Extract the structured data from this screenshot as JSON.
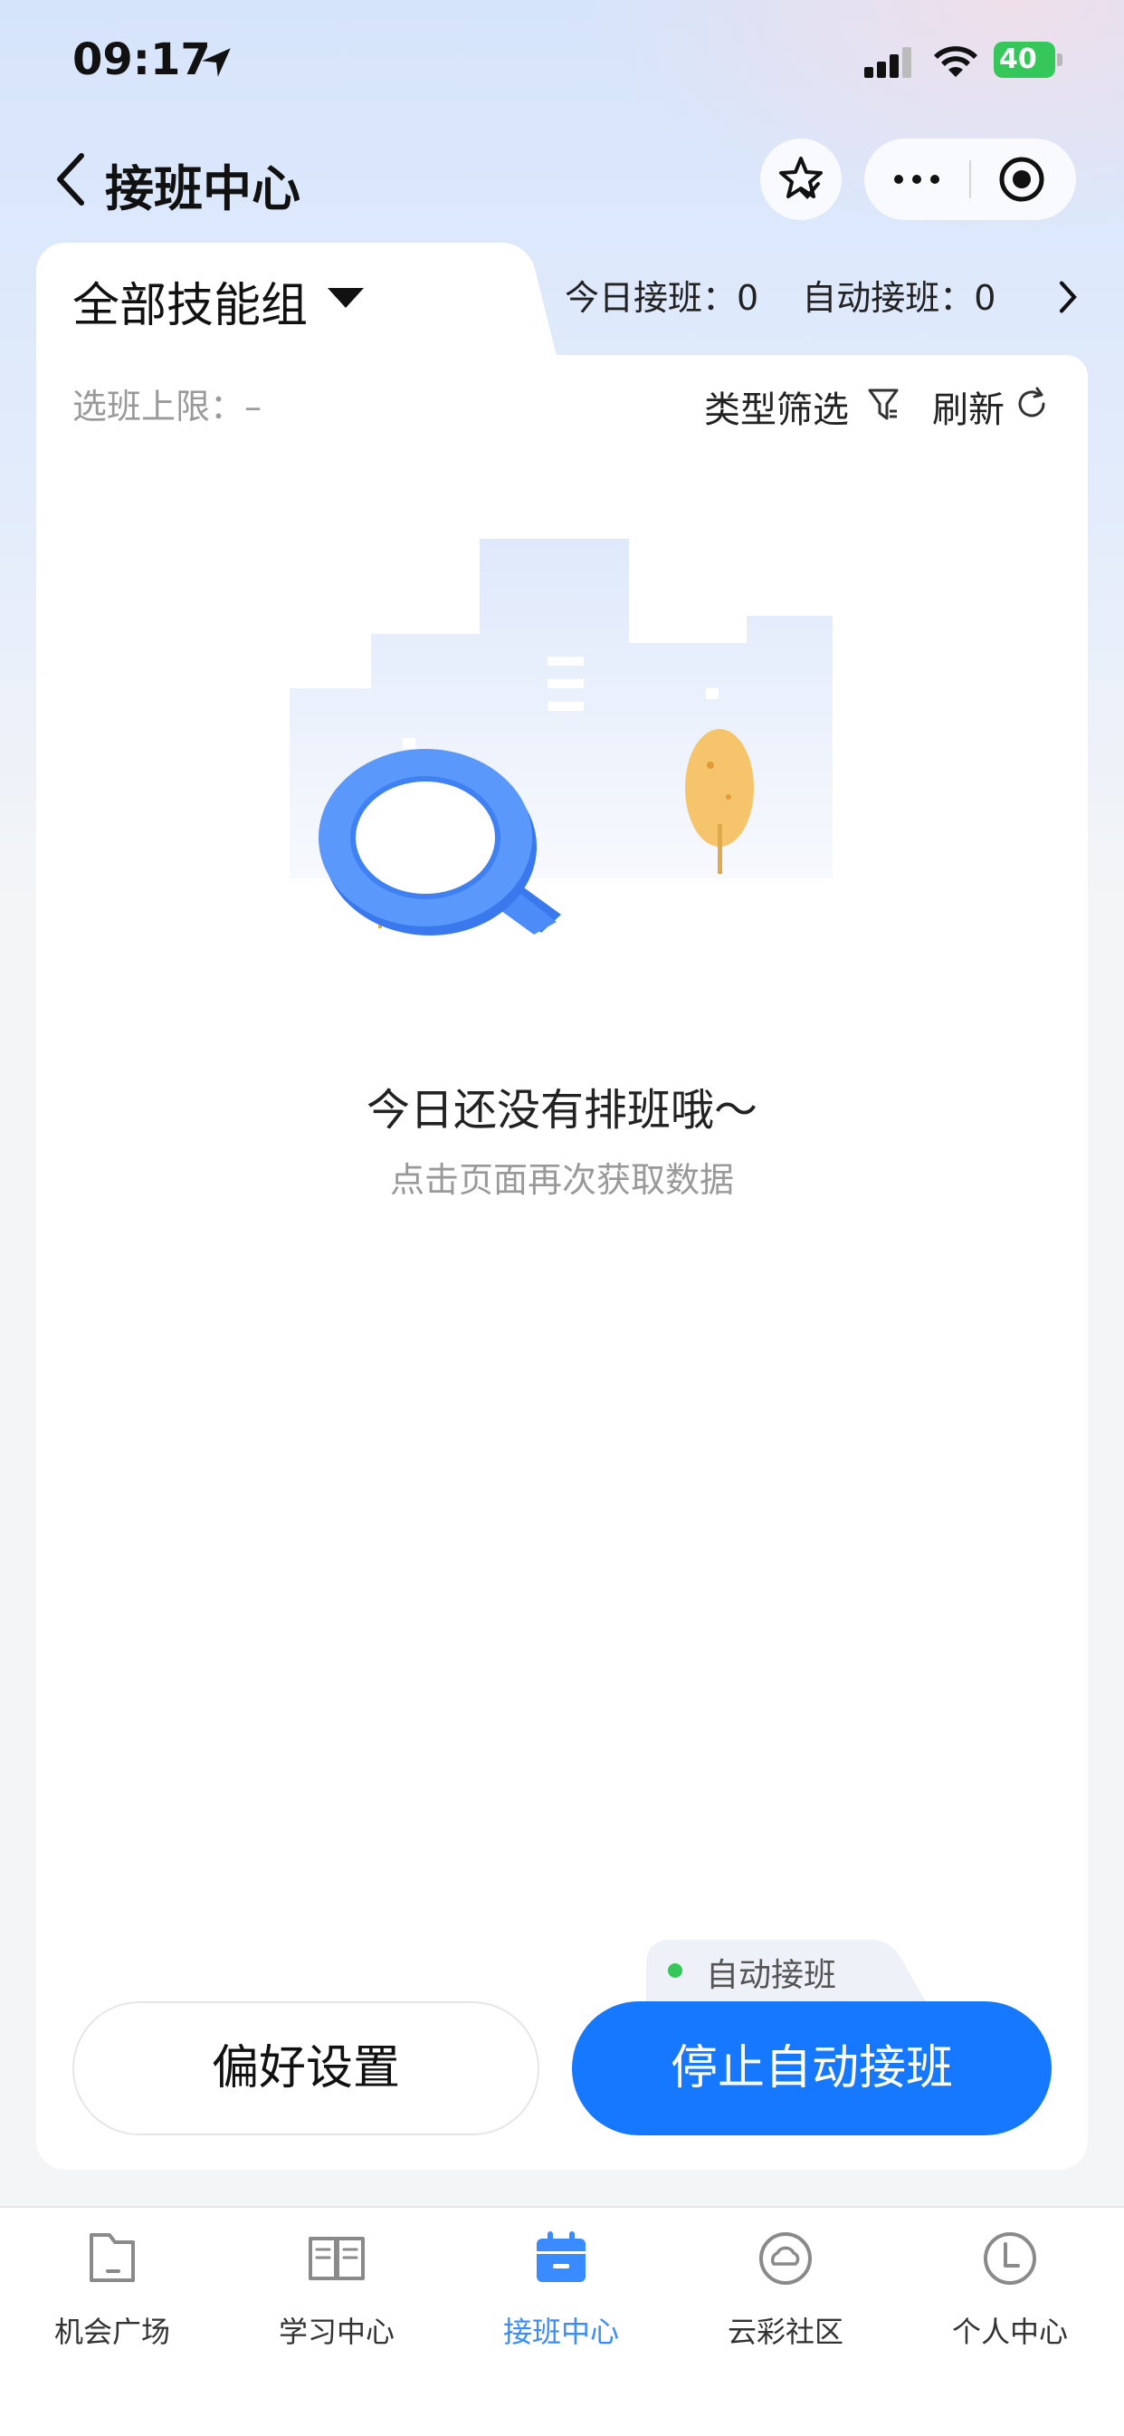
{
  "status_bar": {
    "time": "09:17",
    "battery": "40"
  },
  "nav": {
    "title": "接班中心"
  },
  "group_selector": {
    "label": "全部技能组"
  },
  "stats": {
    "today": "今日接班：0",
    "auto": "自动接班：0"
  },
  "card": {
    "limit": "选班上限：–",
    "filter": "类型筛选",
    "refresh": "刷新"
  },
  "empty": {
    "title": "今日还没有排班哦～",
    "subtitle": "点击页面再次获取数据"
  },
  "actions": {
    "preference": "偏好设置",
    "auto_tag": "自动接班",
    "stop": "停止自动接班"
  },
  "tabbar": {
    "items": [
      {
        "label": "机会广场",
        "icon": "folder-icon"
      },
      {
        "label": "学习中心",
        "icon": "book-icon"
      },
      {
        "label": "接班中心",
        "icon": "calendar-icon",
        "active": true
      },
      {
        "label": "云彩社区",
        "icon": "cloud-icon"
      },
      {
        "label": "个人中心",
        "icon": "person-icon"
      }
    ]
  },
  "colors": {
    "accent": "#1677ff",
    "active_tab": "#3a8bff",
    "status_dot": "#35c759"
  }
}
